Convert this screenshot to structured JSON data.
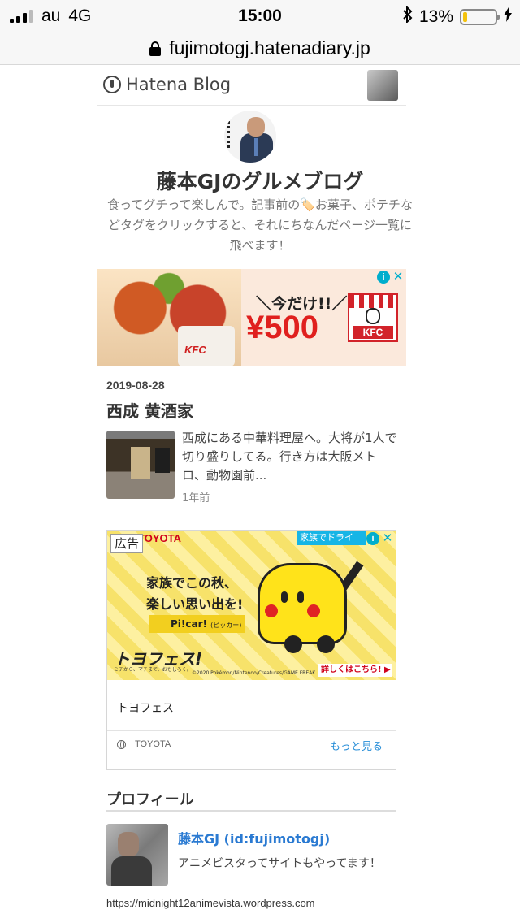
{
  "status_bar": {
    "carrier": "au",
    "network": "4G",
    "time": "15:00",
    "battery_percent": "13%",
    "battery_level": 0.13
  },
  "url_bar": {
    "url": "fujimotogj.hatenadiary.jp"
  },
  "hatena_header": {
    "logo_text": "Hatena Blog"
  },
  "blog": {
    "title": "藤本GJのグルメブログ",
    "description": "食ってグチって楽しんで。記事前の🏷️お菓子、ポテチなどタグをクリックすると、それにちなんだページ一覧に飛べます！"
  },
  "kfc_ad": {
    "tagline": "＼今だけ!!／",
    "price": "¥500",
    "brand": "KFC",
    "wrap_text": "KFC"
  },
  "post": {
    "date": "2019-08-28",
    "title": "西成 黄酒家",
    "excerpt": "西成にある中華料理屋へ。大将が1人で切り盛りしてる。行き方は大阪メトロ、動物園前...",
    "ago": "1年前"
  },
  "toyota_ad": {
    "ad_label": "広告",
    "brand": "TOYOTA",
    "corner": "家族でドライ",
    "catch_line1": "家族でこの秋、",
    "catch_line2": "楽しい思い出を!",
    "pitcar": "Pi!car!",
    "pitcar_sub": "(ピッカー)",
    "logo": "トヨフェス!",
    "logo_sub": "ミチから、マチまで、おもしろく。",
    "copyright": "©2020 Pokémon/Nintendo/Creatures/GAME FREAK.",
    "cta": "詳しくはこちら! ▶",
    "title": "トヨフェス",
    "advertiser": "TOYOTA",
    "more_link": "もっと見る"
  },
  "profile": {
    "heading": "プロフィール",
    "name": "藤本GJ (id:fujimotogj)",
    "bio": "アニメビスタってサイトもやってます！",
    "url": "https://midnight12animevista.wordpress.com"
  },
  "colors": {
    "kfc_red": "#e0201e",
    "link_blue": "#2a7ad2",
    "adchoices": "#00aecd",
    "battery_fill": "#f4c20d"
  }
}
